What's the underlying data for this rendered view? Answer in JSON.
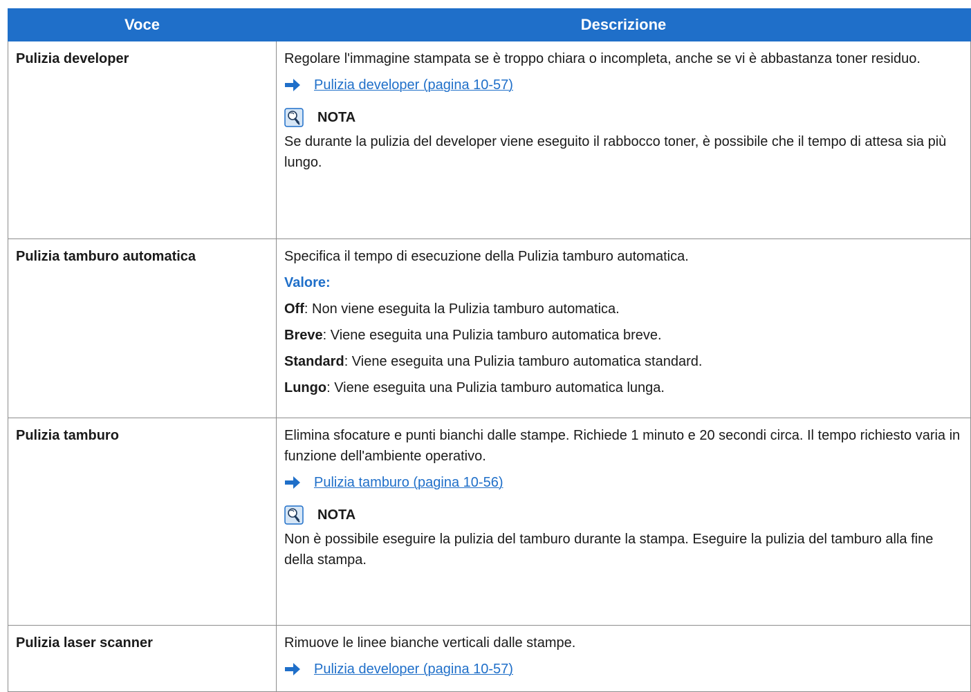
{
  "header": {
    "col1": "Voce",
    "col2": "Descrizione"
  },
  "rows": [
    {
      "item": "Pulizia developer",
      "text": "Regolare l'immagine stampata se è troppo chiara o incompleta, anche se vi è abbastanza toner residuo.",
      "link": "Pulizia developer (pagina 10-57)",
      "note_label": "NOTA",
      "note": "Se durante la pulizia del developer viene eseguito il rabbocco toner, è possibile che il tempo di attesa sia più lungo."
    },
    {
      "item": "Pulizia tamburo automatica",
      "text": "Specifica il tempo di esecuzione della Pulizia tamburo automatica.",
      "values_label": "Valore:",
      "values": [
        {
          "key": "Off",
          "desc": ": Non viene eseguita la Pulizia tamburo automatica."
        },
        {
          "key": "Breve",
          "desc": ": Viene eseguita una Pulizia tamburo automatica breve."
        },
        {
          "key": "Standard",
          "desc": ": Viene eseguita una Pulizia tamburo automatica standard."
        },
        {
          "key": "Lungo",
          "desc": ": Viene eseguita una Pulizia tamburo automatica lunga."
        }
      ]
    },
    {
      "item": "Pulizia tamburo",
      "text": "Elimina sfocature e punti bianchi dalle stampe. Richiede 1 minuto e 20 secondi circa. Il tempo richiesto varia in funzione dell'ambiente operativo.",
      "link": "Pulizia tamburo (pagina 10-56)",
      "note_label": "NOTA",
      "note": "Non è possibile eseguire la pulizia del tamburo durante la stampa. Eseguire la pulizia del tamburo alla fine della stampa."
    },
    {
      "item": "Pulizia laser scanner",
      "text": "Rimuove le linee bianche verticali dalle stampe.",
      "link": "Pulizia developer (pagina 10-57)"
    }
  ],
  "icons": {
    "arrow": "arrow-right-icon",
    "note": "note-bulb-icon"
  },
  "colors": {
    "header_bg": "#1f6fc9",
    "link": "#1f6fc9",
    "accent_text": "#1f6fc9"
  }
}
